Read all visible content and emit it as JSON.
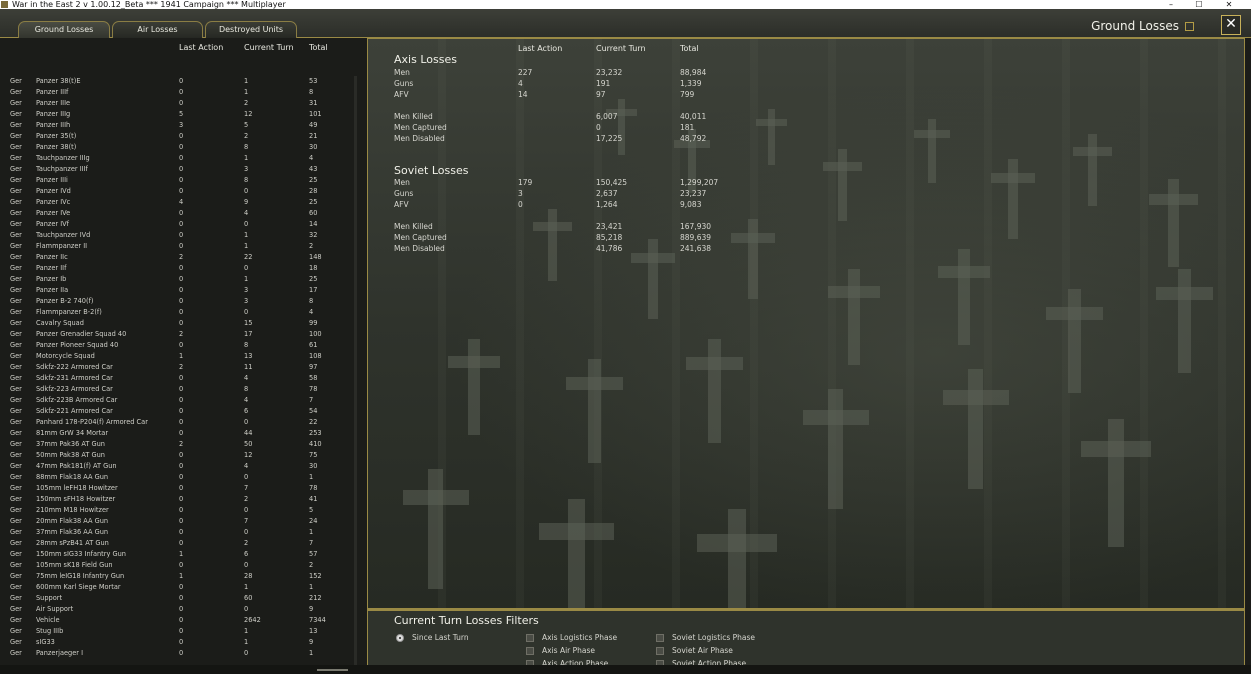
{
  "window": {
    "title": "War in the East 2  v 1.00.12_Beta    ***  1941 Campaign  ***  Multiplayer",
    "minimize": "–",
    "maximize": "☐",
    "close": "✕"
  },
  "tabs": [
    {
      "label": "Ground Losses"
    },
    {
      "label": "Air Losses"
    },
    {
      "label": "Destroyed Units"
    }
  ],
  "header": {
    "title": "Ground Losses",
    "close": "✕"
  },
  "left": {
    "headers": {
      "last_action": "Last Action",
      "current_turn": "Current Turn",
      "total": "Total"
    },
    "rows": [
      [
        "Ger",
        "Panzer 38(t)E",
        "0",
        "1",
        "53"
      ],
      [
        "Ger",
        "Panzer IIIf",
        "0",
        "1",
        "8"
      ],
      [
        "Ger",
        "Panzer IIIe",
        "0",
        "2",
        "31"
      ],
      [
        "Ger",
        "Panzer IIIg",
        "5",
        "12",
        "101"
      ],
      [
        "Ger",
        "Panzer IIIh",
        "3",
        "5",
        "49"
      ],
      [
        "Ger",
        "Panzer 35(t)",
        "0",
        "2",
        "21"
      ],
      [
        "Ger",
        "Panzer 38(t)",
        "0",
        "8",
        "30"
      ],
      [
        "Ger",
        "Tauchpanzer IIIg",
        "0",
        "1",
        "4"
      ],
      [
        "Ger",
        "Tauchpanzer IIIf",
        "0",
        "3",
        "43"
      ],
      [
        "Ger",
        "Panzer IIIi",
        "0",
        "8",
        "25"
      ],
      [
        "Ger",
        "Panzer IVd",
        "0",
        "0",
        "28"
      ],
      [
        "Ger",
        "Panzer IVc",
        "4",
        "9",
        "25"
      ],
      [
        "Ger",
        "Panzer IVe",
        "0",
        "4",
        "60"
      ],
      [
        "Ger",
        "Panzer IVf",
        "0",
        "0",
        "14"
      ],
      [
        "Ger",
        "Tauchpanzer IVd",
        "0",
        "1",
        "32"
      ],
      [
        "Ger",
        "Flammpanzer II",
        "0",
        "1",
        "2"
      ],
      [
        "Ger",
        "Panzer IIc",
        "2",
        "22",
        "148"
      ],
      [
        "Ger",
        "Panzer IIf",
        "0",
        "0",
        "18"
      ],
      [
        "Ger",
        "Panzer Ib",
        "0",
        "1",
        "25"
      ],
      [
        "Ger",
        "Panzer IIa",
        "0",
        "3",
        "17"
      ],
      [
        "Ger",
        "Panzer B-2 740(f)",
        "0",
        "3",
        "8"
      ],
      [
        "Ger",
        "Flammpanzer B-2(f)",
        "0",
        "0",
        "4"
      ],
      [
        "Ger",
        "Cavalry Squad",
        "0",
        "15",
        "99"
      ],
      [
        "Ger",
        "Panzer Grenadier Squad 40",
        "2",
        "17",
        "100"
      ],
      [
        "Ger",
        "Panzer Pioneer Squad 40",
        "0",
        "8",
        "61"
      ],
      [
        "Ger",
        "Motorcycle Squad",
        "1",
        "13",
        "108"
      ],
      [
        "Ger",
        "Sdkfz-222 Armored Car",
        "2",
        "11",
        "97"
      ],
      [
        "Ger",
        "Sdkfz-231 Armored Car",
        "0",
        "4",
        "58"
      ],
      [
        "Ger",
        "Sdkfz-223 Armored Car",
        "0",
        "8",
        "78"
      ],
      [
        "Ger",
        "Sdkfz-223B Armored Car",
        "0",
        "4",
        "7"
      ],
      [
        "Ger",
        "Sdkfz-221 Armored Car",
        "0",
        "6",
        "54"
      ],
      [
        "Ger",
        "Panhard 178-P204(f) Armored Car",
        "0",
        "0",
        "22"
      ],
      [
        "Ger",
        "81mm GrW 34 Mortar",
        "0",
        "44",
        "253"
      ],
      [
        "Ger",
        "37mm Pak36 AT Gun",
        "2",
        "50",
        "410"
      ],
      [
        "Ger",
        "50mm Pak38 AT Gun",
        "0",
        "12",
        "75"
      ],
      [
        "Ger",
        "47mm Pak181(f) AT Gun",
        "0",
        "4",
        "30"
      ],
      [
        "Ger",
        "88mm Flak18 AA Gun",
        "0",
        "0",
        "1"
      ],
      [
        "Ger",
        "105mm leFH18 Howitzer",
        "0",
        "7",
        "78"
      ],
      [
        "Ger",
        "150mm sFH18 Howitzer",
        "0",
        "2",
        "41"
      ],
      [
        "Ger",
        "210mm M18 Howitzer",
        "0",
        "0",
        "5"
      ],
      [
        "Ger",
        "20mm Flak38 AA Gun",
        "0",
        "7",
        "24"
      ],
      [
        "Ger",
        "37mm Flak36 AA Gun",
        "0",
        "0",
        "1"
      ],
      [
        "Ger",
        "28mm sPzB41 AT Gun",
        "0",
        "2",
        "7"
      ],
      [
        "Ger",
        "150mm sIG33 Infantry Gun",
        "1",
        "6",
        "57"
      ],
      [
        "Ger",
        "105mm sK18 Field Gun",
        "0",
        "0",
        "2"
      ],
      [
        "Ger",
        "75mm leIG18 Infantry Gun",
        "1",
        "28",
        "152"
      ],
      [
        "Ger",
        "600mm Karl Siege Mortar",
        "0",
        "1",
        "1"
      ],
      [
        "Ger",
        "Support",
        "0",
        "60",
        "212"
      ],
      [
        "Ger",
        "Air Support",
        "0",
        "0",
        "9"
      ],
      [
        "Ger",
        "Vehicle",
        "0",
        "2642",
        "7344"
      ],
      [
        "Ger",
        "Stug IIIb",
        "0",
        "1",
        "13"
      ],
      [
        "Ger",
        "sIG33",
        "0",
        "1",
        "9"
      ],
      [
        "Ger",
        "Panzerjaeger I",
        "0",
        "0",
        "1"
      ]
    ]
  },
  "right": {
    "headers": {
      "last_action": "Last Action",
      "current_turn": "Current Turn",
      "total": "Total"
    },
    "axis": {
      "title": "Axis Losses",
      "rows": [
        [
          "Men",
          "227",
          "23,232",
          "88,984"
        ],
        [
          "Guns",
          "4",
          "191",
          "1,339"
        ],
        [
          "AFV",
          "14",
          "97",
          "799"
        ]
      ],
      "detail": [
        [
          "Men Killed",
          "",
          "6,007",
          "40,011"
        ],
        [
          "Men Captured",
          "",
          "0",
          "181"
        ],
        [
          "Men Disabled",
          "",
          "17,225",
          "48,792"
        ]
      ]
    },
    "soviet": {
      "title": "Soviet Losses",
      "rows": [
        [
          "Men",
          "179",
          "150,425",
          "1,299,207"
        ],
        [
          "Guns",
          "3",
          "2,637",
          "23,237"
        ],
        [
          "AFV",
          "0",
          "1,264",
          "9,083"
        ]
      ],
      "detail": [
        [
          "Men Killed",
          "",
          "23,421",
          "167,930"
        ],
        [
          "Men Captured",
          "",
          "85,218",
          "889,639"
        ],
        [
          "Men Disabled",
          "",
          "41,786",
          "241,638"
        ]
      ]
    }
  },
  "filters": {
    "title": "Current Turn Losses Filters",
    "since_last_turn": "Since Last Turn",
    "axis_logistics": "Axis Logistics Phase",
    "axis_air": "Axis Air Phase",
    "axis_action": "Axis Action Phase",
    "soviet_logistics": "Soviet Logistics Phase",
    "soviet_air": "Soviet Air Phase",
    "soviet_action": "Soviet Action Phase"
  }
}
